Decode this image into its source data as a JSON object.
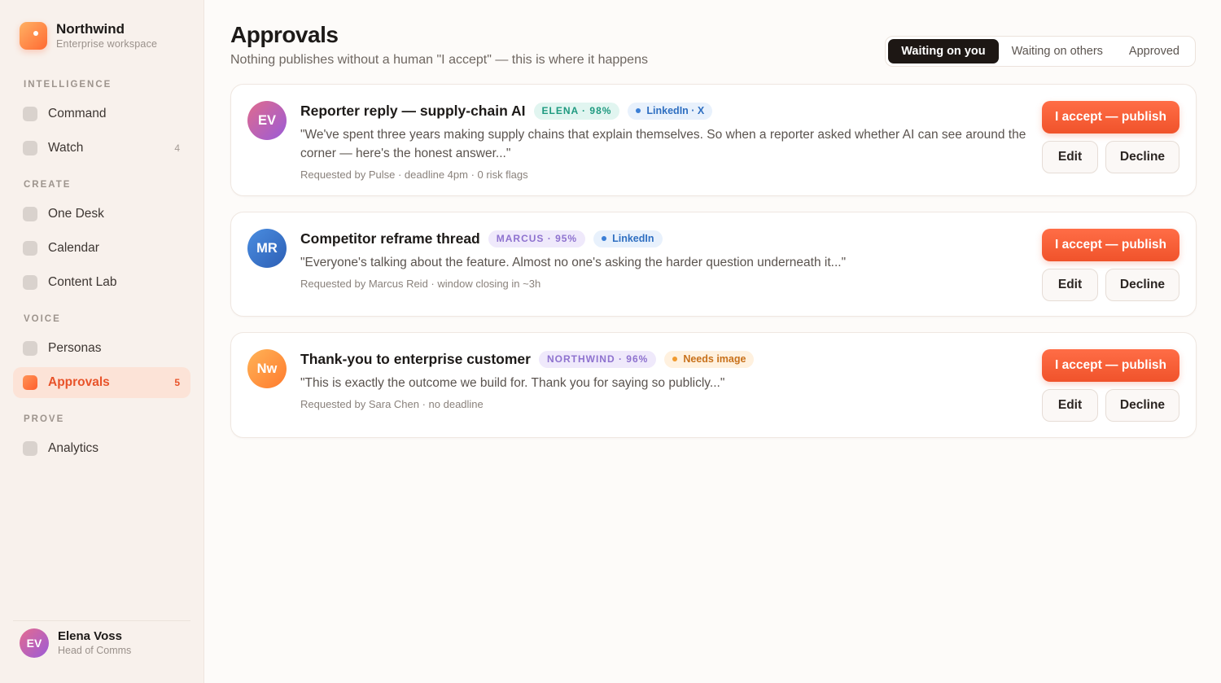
{
  "brand": {
    "name": "Northwind",
    "subtitle": "Enterprise workspace"
  },
  "sidebar": {
    "sections": [
      {
        "label": "INTELLIGENCE"
      },
      {
        "label": "CREATE"
      },
      {
        "label": "VOICE"
      },
      {
        "label": "PROVE"
      }
    ],
    "items": [
      {
        "label": "Command",
        "count": ""
      },
      {
        "label": "Watch",
        "count": "4"
      },
      {
        "label": "One Desk",
        "count": ""
      },
      {
        "label": "Calendar",
        "count": ""
      },
      {
        "label": "Content Lab",
        "count": ""
      },
      {
        "label": "Personas",
        "count": ""
      },
      {
        "label": "Approvals",
        "count": "5",
        "active": true
      },
      {
        "label": "Analytics",
        "count": ""
      }
    ]
  },
  "user": {
    "initials": "EV",
    "name": "Elena Voss",
    "role": "Head of Comms"
  },
  "page": {
    "title": "Approvals",
    "subtitle": "Nothing publishes without a human \"I accept\" — this is where it happens"
  },
  "tabs": [
    {
      "label": "Waiting on you",
      "active": true
    },
    {
      "label": "Waiting on others",
      "active": false
    },
    {
      "label": "Approved",
      "active": false
    }
  ],
  "actions": {
    "accept_label": "I accept — publish",
    "edit_label": "Edit",
    "decline_label": "Decline"
  },
  "approvals": [
    {
      "initials": "EV",
      "title": "Reporter reply — supply-chain AI",
      "persona": "ELENA · 98%",
      "tag": "LinkedIn · X",
      "body": "\"We've spent three years making supply chains that explain themselves. So when a reporter asked whether AI can see around the corner — here's the honest answer...\"",
      "meta": "Requested by Pulse · deadline 4pm · 0 risk flags"
    },
    {
      "initials": "MR",
      "title": "Competitor reframe thread",
      "persona": "MARCUS · 95%",
      "tag": "LinkedIn",
      "body": "\"Everyone's talking about the feature. Almost no one's asking the harder question underneath it...\"",
      "meta": "Requested by Marcus Reid · window closing in ~3h"
    },
    {
      "initials": "Nw",
      "title": "Thank-you to enterprise customer",
      "persona": "NORTHWIND · 96%",
      "tag": "Needs image",
      "body": "\"This is exactly the outcome we build for. Thank you for saying so publicly...\"",
      "meta": "Requested by Sara Chen · no deadline"
    }
  ],
  "colors": {
    "accent": "#f0532b",
    "sidebar_bg": "#f8f1ec",
    "active_bg": "#fce3d7",
    "persona_teal": "#1f9a80",
    "persona_purple": "#8e72cf",
    "tag_blue": "#2f6fc1",
    "tag_amber": "#c8711b"
  },
  "icons": {
    "brand": "northwind-logo-icon",
    "nav": "nav-square-icon",
    "tag": "status-dot-icon"
  }
}
